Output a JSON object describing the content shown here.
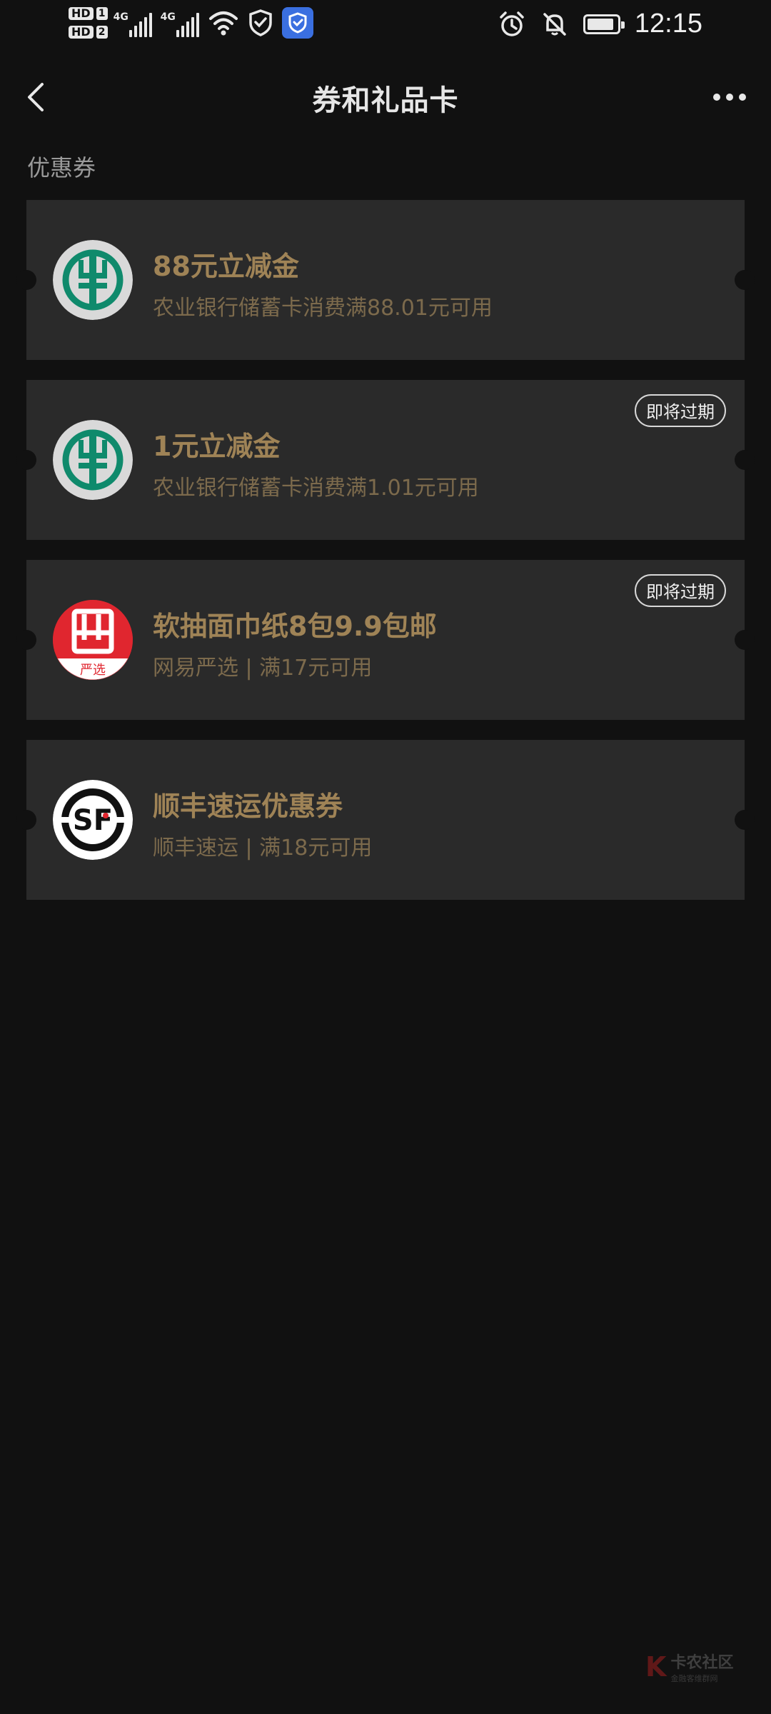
{
  "status_bar": {
    "time": "12:15",
    "sim1_label": "HD",
    "sim1_slot": "1",
    "sim2_label": "HD",
    "sim2_slot": "2",
    "network1": "4G",
    "network2": "4G",
    "battery_level": 0.9
  },
  "nav": {
    "title": "券和礼品卡",
    "back_icon": "chevron-left-icon",
    "more_icon": "more-horizontal-icon"
  },
  "section": {
    "title": "优惠券"
  },
  "coupons": [
    {
      "title": "88元立减金",
      "description": "农业银行储蓄卡消费满88.01元可用",
      "logo": "abc-bank-logo",
      "badge": ""
    },
    {
      "title": "1元立减金",
      "description": "农业银行储蓄卡消费满1.01元可用",
      "logo": "abc-bank-logo",
      "badge": "即将过期"
    },
    {
      "title": "软抽面巾纸8包9.9包邮",
      "description": "网易严选 | 满17元可用",
      "logo": "yanxuan-logo",
      "logo_caption": "严选",
      "badge": "即将过期"
    },
    {
      "title": "顺丰速运优惠券",
      "description": "顺丰速运 | 满18元可用",
      "logo": "sf-express-logo",
      "badge": ""
    }
  ],
  "colors": {
    "background": "#111111",
    "card": "#2a2a2a",
    "coupon_title": "#9f8356",
    "coupon_desc": "#7c6a4c",
    "abc_green": "#0f8a6c",
    "yanxuan_red": "#e0262f"
  },
  "watermark": {
    "line1": "卡农社区",
    "line2": "金融客维群网"
  }
}
